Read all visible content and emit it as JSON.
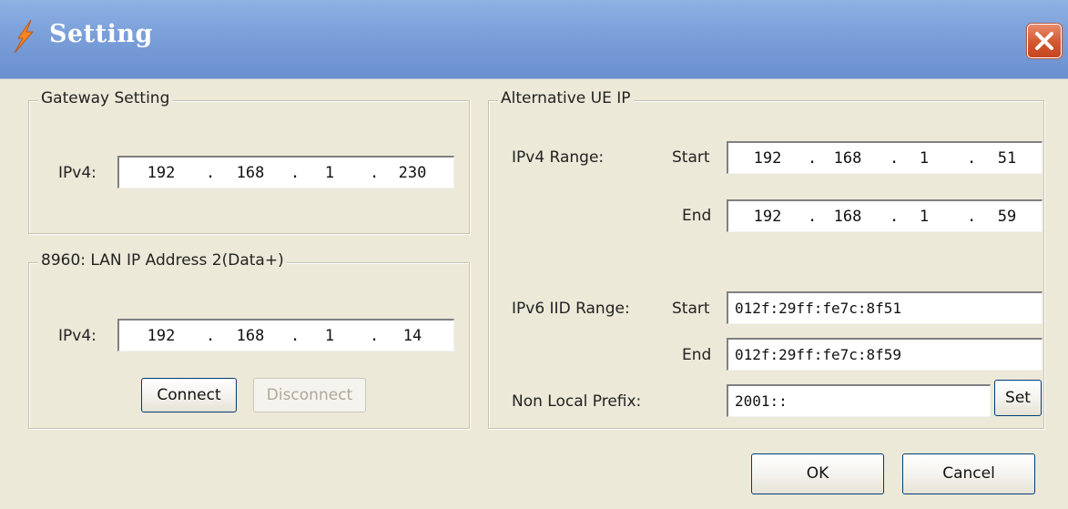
{
  "window": {
    "title": "Setting"
  },
  "gateway": {
    "legend": "Gateway Setting",
    "ipv4_label": "IPv4:",
    "ip": [
      "192",
      "168",
      "1",
      "230"
    ]
  },
  "lan": {
    "legend": "8960: LAN IP Address 2(Data+)",
    "ipv4_label": "IPv4:",
    "ip": [
      "192",
      "168",
      "1",
      "14"
    ],
    "connect_label": "Connect",
    "disconnect_label": "Disconnect"
  },
  "alt": {
    "legend": "Alternative UE IP",
    "ipv4_range_label": "IPv4 Range:",
    "start_label": "Start",
    "end_label": "End",
    "ipv4_start": [
      "192",
      "168",
      "1",
      "51"
    ],
    "ipv4_end": [
      "192",
      "168",
      "1",
      "59"
    ],
    "ipv6_range_label": "IPv6 IID Range:",
    "ipv6_start_label": "Start",
    "ipv6_end_label": "End",
    "ipv6_start": "012f:29ff:fe7c:8f51",
    "ipv6_end": "012f:29ff:fe7c:8f59",
    "prefix_label": "Non Local Prefix:",
    "prefix_value": "2001::",
    "set_label": "Set"
  },
  "footer": {
    "ok_label": "OK",
    "cancel_label": "Cancel"
  }
}
